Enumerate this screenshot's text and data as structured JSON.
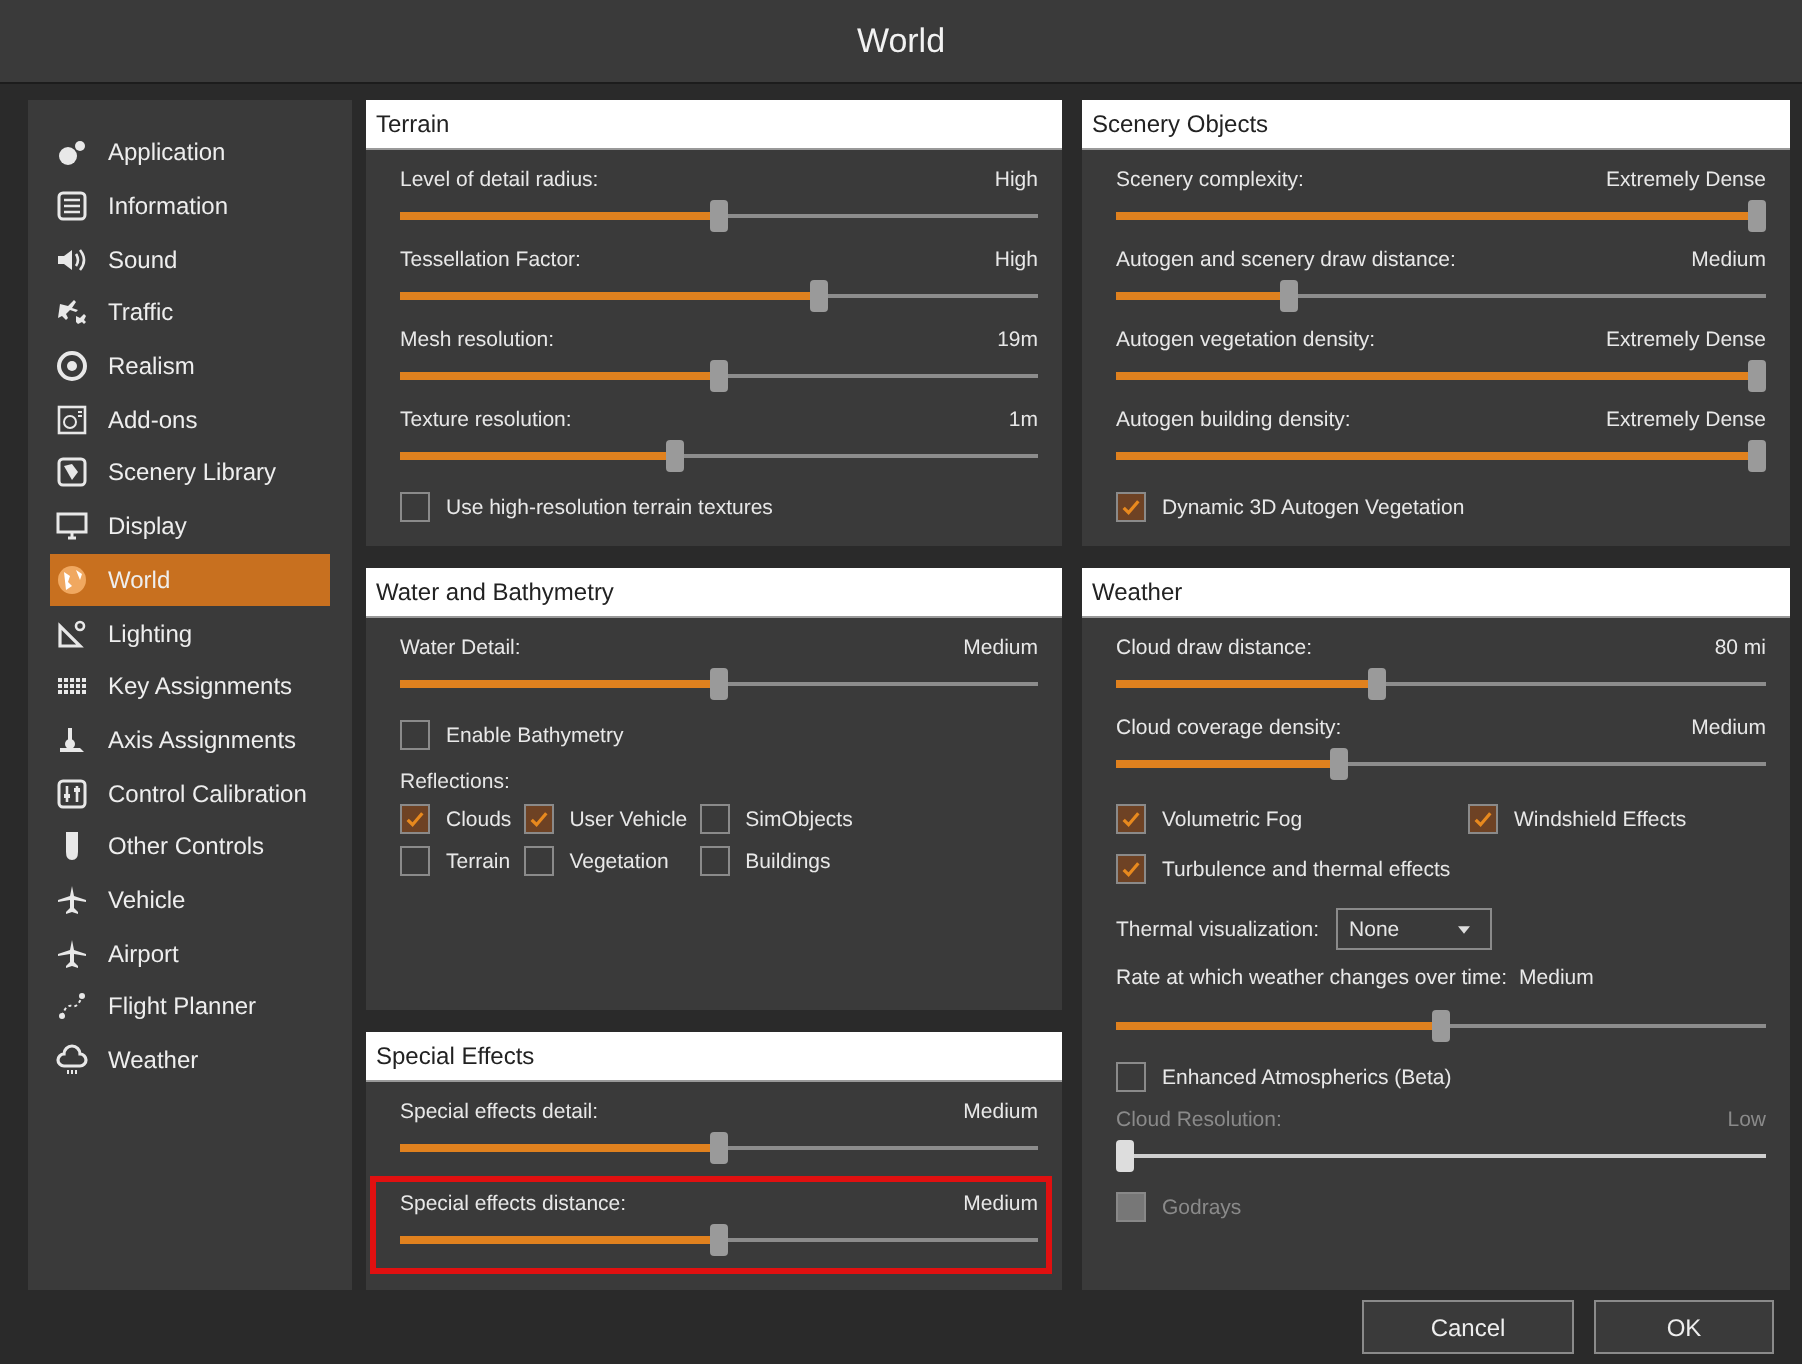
{
  "window": {
    "title": "World"
  },
  "sidebar": {
    "items": [
      {
        "label": "Application",
        "selected": false
      },
      {
        "label": "Information",
        "selected": false
      },
      {
        "label": "Sound",
        "selected": false
      },
      {
        "label": "Traffic",
        "selected": false
      },
      {
        "label": "Realism",
        "selected": false
      },
      {
        "label": "Add-ons",
        "selected": false
      },
      {
        "label": "Scenery Library",
        "selected": false
      },
      {
        "label": "Display",
        "selected": false
      },
      {
        "label": "World",
        "selected": true
      },
      {
        "label": "Lighting",
        "selected": false
      },
      {
        "label": "Key Assignments",
        "selected": false
      },
      {
        "label": "Axis Assignments",
        "selected": false
      },
      {
        "label": "Control Calibration",
        "selected": false
      },
      {
        "label": "Other Controls",
        "selected": false
      },
      {
        "label": "Vehicle",
        "selected": false
      },
      {
        "label": "Airport",
        "selected": false
      },
      {
        "label": "Flight Planner",
        "selected": false
      },
      {
        "label": "Weather",
        "selected": false
      }
    ]
  },
  "columns": [
    {
      "panels": [
        {
          "title": "Terrain",
          "items": [
            {
              "kind": "slider",
              "label": "Level of detail radius:",
              "reading": "High",
              "level": 0.5
            },
            {
              "kind": "slider",
              "label": "Tessellation Factor:",
              "reading": "High",
              "level": 0.66
            },
            {
              "kind": "slider",
              "label": "Mesh resolution:",
              "reading": "19m",
              "level": 0.5
            },
            {
              "kind": "slider",
              "label": "Texture resolution:",
              "reading": "1m",
              "level": 0.43
            },
            {
              "kind": "checkbox",
              "label": "Use high-resolution terrain textures",
              "checked": false
            }
          ]
        },
        {
          "title": "Water and Bathymetry",
          "items": [
            {
              "kind": "slider",
              "label": "Water Detail:",
              "reading": "Medium",
              "level": 0.5
            },
            {
              "kind": "checkbox",
              "label": "Enable Bathymetry",
              "checked": false
            },
            {
              "kind": "heading",
              "text": "Reflections:"
            },
            {
              "kind": "checkbox_grid",
              "items": [
                {
                  "label": "Clouds",
                  "checked": true
                },
                {
                  "label": "User Vehicle",
                  "checked": true
                },
                {
                  "label": "SimObjects",
                  "checked": false
                },
                {
                  "label": "Terrain",
                  "checked": false
                },
                {
                  "label": "Vegetation",
                  "checked": false
                },
                {
                  "label": "Buildings",
                  "checked": false
                }
              ]
            }
          ]
        },
        {
          "title": "Special Effects",
          "items": [
            {
              "kind": "slider",
              "label": "Special effects detail:",
              "reading": "Medium",
              "level": 0.5,
              "highlighted": false
            },
            {
              "kind": "slider",
              "label": "Special effects distance:",
              "reading": "Medium",
              "level": 0.5,
              "highlighted": true
            }
          ]
        }
      ]
    },
    {
      "panels": [
        {
          "title": "Scenery Objects",
          "items": [
            {
              "kind": "slider",
              "label": "Scenery complexity:",
              "reading": "Extremely Dense",
              "level": 1
            },
            {
              "kind": "slider",
              "label": "Autogen and scenery draw distance:",
              "reading": "Medium",
              "level": 0.26
            },
            {
              "kind": "slider",
              "label": "Autogen vegetation density:",
              "reading": "Extremely Dense",
              "level": 1
            },
            {
              "kind": "slider",
              "label": "Autogen building density:",
              "reading": "Extremely Dense",
              "level": 1
            },
            {
              "kind": "checkbox",
              "label": "Dynamic 3D Autogen Vegetation",
              "checked": true
            }
          ]
        },
        {
          "title": "Weather",
          "items": [
            {
              "kind": "slider",
              "label": "Cloud draw distance:",
              "reading": "80 mi",
              "level": 0.4,
              "disabled": false
            },
            {
              "kind": "slider",
              "label": "Cloud coverage density:",
              "reading": "Medium",
              "level": 0.34,
              "disabled": false
            },
            {
              "kind": "checkbox_row",
              "items": [
                {
                  "label": "Volumetric Fog",
                  "checked": true,
                  "disabled": false
                },
                {
                  "label": "Windshield Effects",
                  "checked": true,
                  "disabled": false
                }
              ]
            },
            {
              "kind": "checkbox",
              "label": "Turbulence and thermal effects",
              "checked": true,
              "disabled": false
            },
            {
              "kind": "dropdown",
              "label": "Thermal visualization:",
              "value": "None"
            },
            {
              "kind": "inline_slider",
              "label": "Rate at which weather changes over time:",
              "reading": "Medium",
              "level": 0.5
            },
            {
              "kind": "checkbox",
              "label": "Enhanced Atmospherics (Beta)",
              "checked": false,
              "disabled": false
            },
            {
              "kind": "slider",
              "label": "Cloud Resolution:",
              "reading": "Low",
              "level": 0,
              "disabled": true
            },
            {
              "kind": "checkbox",
              "label": "Godrays",
              "checked": false,
              "disabled": true
            }
          ]
        }
      ]
    }
  ],
  "buttons": [
    "Cancel",
    "OK"
  ]
}
